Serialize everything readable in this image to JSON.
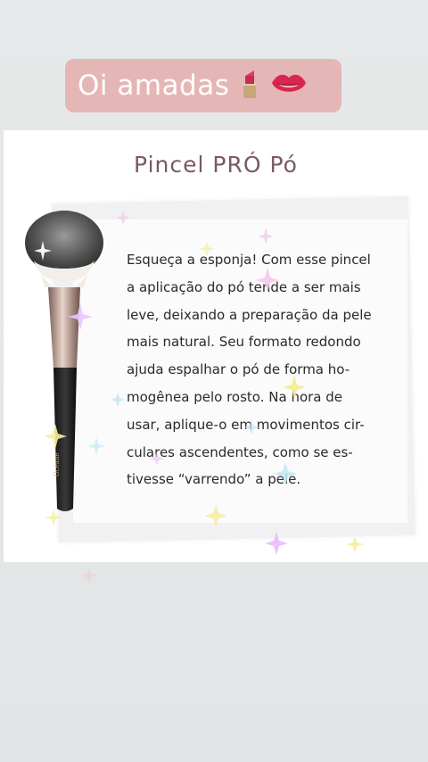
{
  "story_banner": {
    "text": "Oi amadas",
    "emoji_icons": [
      "lipstick-icon",
      "lips-icon"
    ],
    "background_color": "#e5b6b6",
    "text_color": "#ffffff"
  },
  "card": {
    "title": "Pincel PRÓ Pó",
    "title_color": "#7b5a62",
    "body_lines": [
      "Esqueça a esponja! Com esse pincel",
      "a aplicação do pó tende a ser mais",
      "leve, deixando a preparação da pele",
      "mais natural. Seu formato redondo",
      "ajuda espalhar o pó de forma ho-",
      "mogênea pelo rosto.  Na hora de",
      "usar, aplique-o em movimentos cir-",
      "culares ascendentes, como se es-",
      "tivesse “varrendo” a pele."
    ],
    "image": "makeup-brush-icon"
  }
}
